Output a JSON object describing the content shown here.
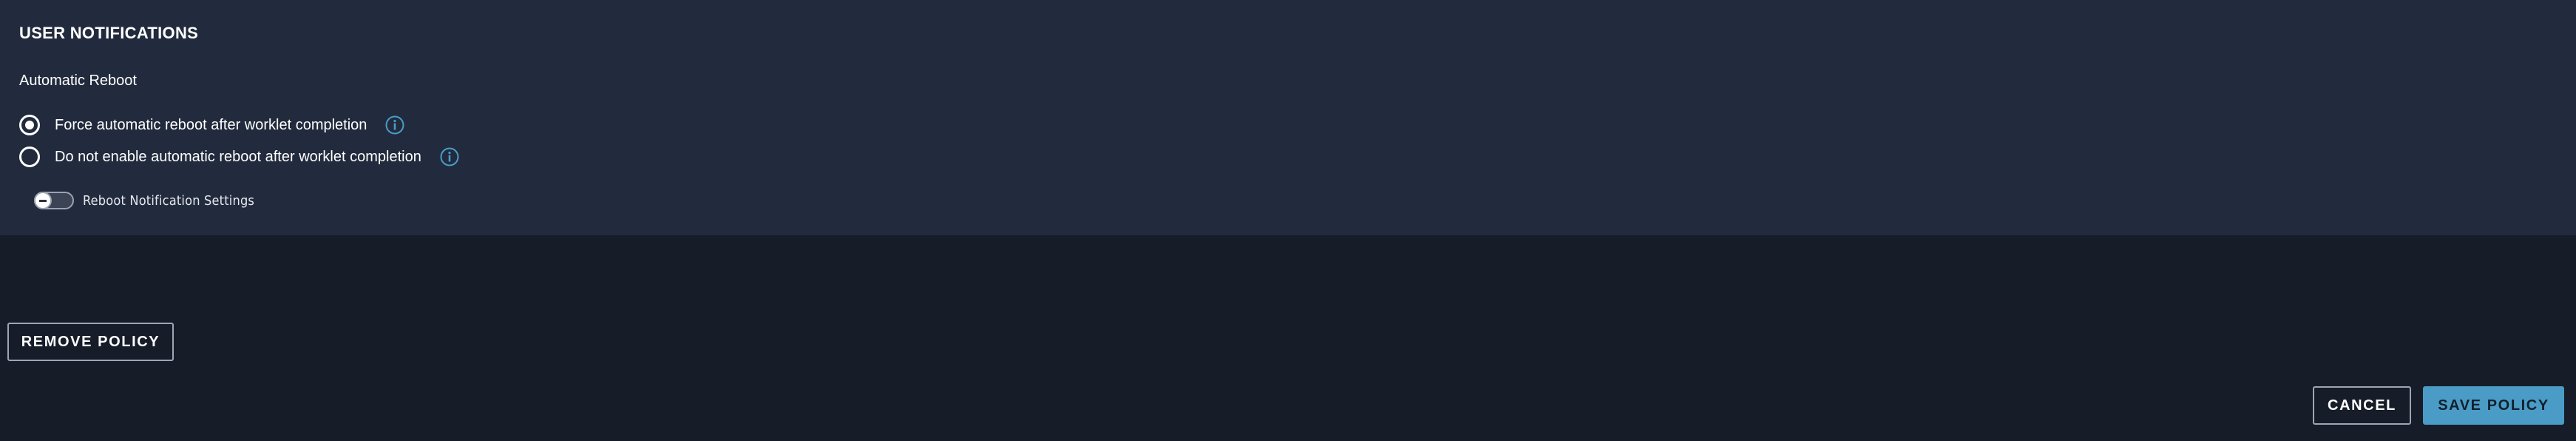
{
  "section": {
    "title": "USER NOTIFICATIONS",
    "subtitle": "Automatic Reboot"
  },
  "reboot_options": [
    {
      "label": "Force automatic reboot after worklet completion",
      "selected": true,
      "icon": "info-icon"
    },
    {
      "label": "Do not enable automatic reboot after worklet completion",
      "selected": false,
      "icon": "info-icon"
    }
  ],
  "notification_toggle": {
    "label": "Reboot Notification Settings",
    "enabled": false
  },
  "actions": {
    "remove_label": "REMOVE POLICY",
    "cancel_label": "CANCEL",
    "save_label": "SAVE POLICY"
  },
  "colors": {
    "panel_bg": "#222b3d",
    "page_bg": "#161c28",
    "accent": "#4a9cc6",
    "info_icon": "#4a9cc6"
  }
}
